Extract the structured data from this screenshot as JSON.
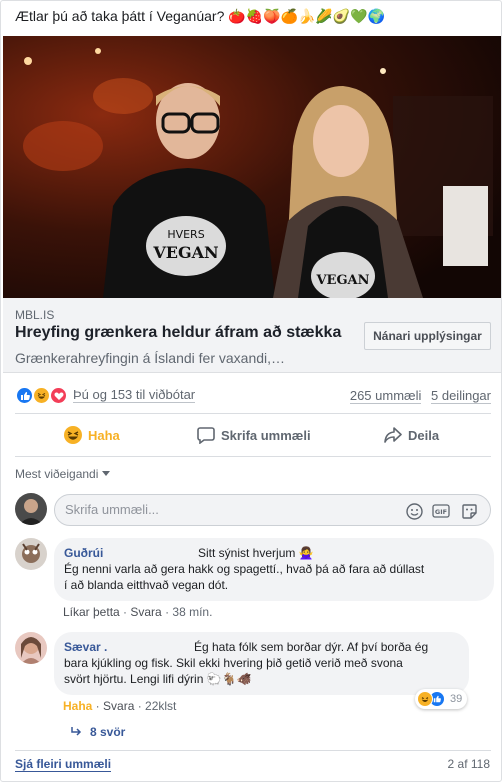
{
  "post": {
    "text": "Ætlar þú að taka þátt í Veganúar? 🍅🍓🍑🍊🍌🌽🥑💚🌍"
  },
  "link": {
    "domain": "MBL.IS",
    "headline": "Hreyfing grænkera heldur áfram að stækka",
    "description": "Grænkerahreyfingin á Íslandi fer vaxandi,…",
    "button_label": "Nánari upplýsingar"
  },
  "photo": {
    "shirt_text_1": "HVERS",
    "shirt_text_2": "VEGAN"
  },
  "reactions": {
    "summary": "Þú og 153 til viðbótar",
    "comments_count": "265 ummæli",
    "shares_count": "5 deilingar"
  },
  "actions": {
    "haha_label": "Haha",
    "comment_label": "Skrifa ummæli",
    "share_label": "Deila"
  },
  "sort": {
    "label": "Mest viðeigandi"
  },
  "composer": {
    "placeholder": "Skrifa ummæli..."
  },
  "comments": [
    {
      "name": "Guðrúi",
      "headline": "Sitt sýnist hverjum 🙅‍♀️",
      "lines": [
        "Ég nenni varla að gera hakk og spagettí., hvað þá að fara að dúllast",
        "í að blanda eitthvað vegan dót."
      ],
      "like": "Líkar þetta",
      "reply": "Svara",
      "time": "38 mín."
    },
    {
      "name": "Sævar .",
      "headline": "Ég hata fólk sem borðar dýr. Af því borða ég",
      "lines": [
        "bara kjúkling og fisk. Skil ekki hvering þið getið verið með svona",
        "svört hjörtu. Lengi lifi dýrin 🐑🐐🐗"
      ],
      "like": "Haha",
      "reply": "Svara",
      "time": "22klst",
      "reaction_count": "39"
    }
  ],
  "replies_label": "8 svör",
  "footer": {
    "see_more": "Sjá fleiri ummæli",
    "pager": "2 af 118"
  },
  "colors": {
    "link_blue": "#385898",
    "haha_yellow": "#f7b125",
    "like_blue": "#1877f2",
    "love_red": "#f33e58"
  }
}
